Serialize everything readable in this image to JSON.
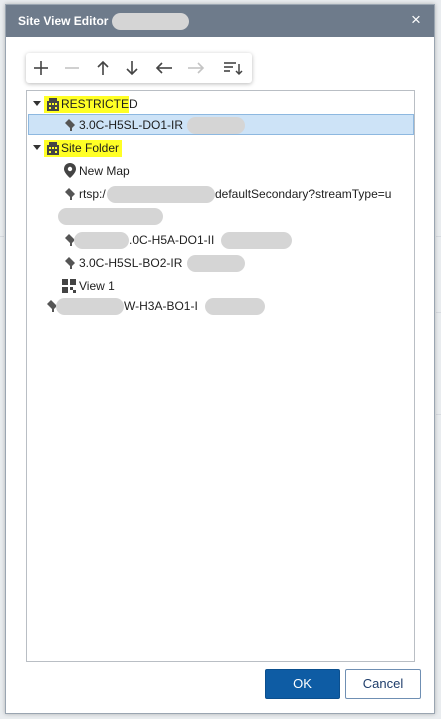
{
  "dialog": {
    "title": "Site View Editor",
    "close_glyph": "×"
  },
  "toolbar": {
    "buttons": [
      {
        "name": "add",
        "icon": "plus-icon",
        "glyph": "+",
        "enabled": true
      },
      {
        "name": "remove",
        "icon": "minus-icon",
        "glyph": "−",
        "enabled": false
      },
      {
        "name": "move-up",
        "icon": "arrow-up-icon",
        "glyph": "↑",
        "enabled": true
      },
      {
        "name": "move-down",
        "icon": "arrow-down-icon",
        "glyph": "↓",
        "enabled": true
      },
      {
        "name": "move-out",
        "icon": "arrow-left-icon",
        "glyph": "←",
        "enabled": true
      },
      {
        "name": "move-in",
        "icon": "arrow-right-icon",
        "glyph": "→",
        "enabled": false
      },
      {
        "name": "sort",
        "icon": "sort-icon",
        "glyph": "",
        "enabled": true
      }
    ]
  },
  "tree": {
    "restricted": {
      "label": "RESTRICTED",
      "icon": "building-icon"
    },
    "restricted_children": [
      {
        "label": "3.0C-H5SL-DO1-IR",
        "icon": "camera-icon"
      }
    ],
    "site_folder": {
      "label": "Site Folder",
      "icon": "building-icon"
    },
    "site_children": [
      {
        "label": "New Map",
        "icon": "map-pin-icon"
      },
      {
        "label_prefix": "rtsp:/",
        "label_suffix": "defaultSecondary?streamType=u",
        "icon": "camera-icon"
      },
      {
        "label": ".0C-H5A-DO1-II",
        "icon": "camera-icon"
      },
      {
        "label": "3.0C-H5SL-BO2-IR",
        "icon": "camera-icon"
      },
      {
        "label": "View 1",
        "icon": "view-grid-icon"
      }
    ],
    "root_items": [
      {
        "label": "W-H3A-BO1-I",
        "icon": "camera-icon"
      }
    ]
  },
  "footer": {
    "ok_label": "OK",
    "cancel_label": "Cancel"
  },
  "colors": {
    "titlebar": "#6e7b8b",
    "highlight": "#ffff25",
    "selection": "#cde3f7",
    "primary": "#0e5ca4"
  }
}
